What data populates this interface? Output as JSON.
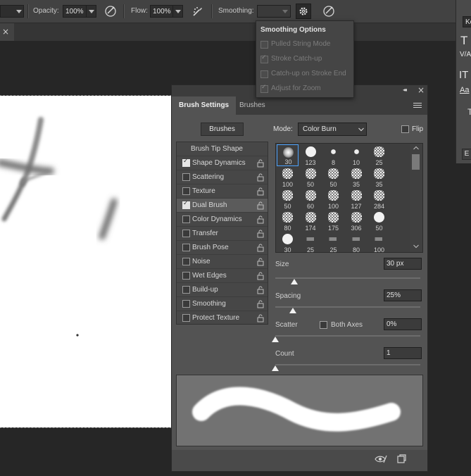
{
  "options_bar": {
    "opacity_label": "Opacity:",
    "opacity_value": "100%",
    "flow_label": "Flow:",
    "flow_value": "100%",
    "smoothing_label": "Smoothing:",
    "smoothing_value": ""
  },
  "tab_strip": {
    "close_glyph": "×"
  },
  "smoothing_popup": {
    "title": "Smoothing Options",
    "items": [
      {
        "label": "Pulled String Mode",
        "checked": false
      },
      {
        "label": "Stroke Catch-up",
        "checked": true
      },
      {
        "label": "Catch-up on Stroke End",
        "checked": false
      },
      {
        "label": "Adjust for Zoom",
        "checked": true
      }
    ]
  },
  "char_panel": {
    "font_field": "Ko",
    "glyphs": [
      "T",
      "V/A",
      "IT",
      "Aa",
      "T",
      "E"
    ]
  },
  "panel": {
    "collapse_glyph": "◂◂",
    "close_glyph": "×",
    "tabs": [
      {
        "label": "Brush Settings",
        "active": true
      },
      {
        "label": "Brushes",
        "active": false
      }
    ],
    "brushes_button": "Brushes",
    "mode_label": "Mode:",
    "mode_value": "Color Burn",
    "flip_label": "Flip",
    "options": [
      {
        "label": "Brush Tip Shape",
        "checked": null,
        "lock": false
      },
      {
        "label": "Shape Dynamics",
        "checked": true,
        "lock": true
      },
      {
        "label": "Scattering",
        "checked": false,
        "lock": true
      },
      {
        "label": "Texture",
        "checked": false,
        "lock": true
      },
      {
        "label": "Dual Brush",
        "checked": true,
        "lock": true,
        "selected": true
      },
      {
        "label": "Color Dynamics",
        "checked": false,
        "lock": true
      },
      {
        "label": "Transfer",
        "checked": false,
        "lock": true
      },
      {
        "label": "Brush Pose",
        "checked": false,
        "lock": true
      },
      {
        "label": "Noise",
        "checked": false,
        "lock": true
      },
      {
        "label": "Wet Edges",
        "checked": false,
        "lock": true
      },
      {
        "label": "Build-up",
        "checked": false,
        "lock": true
      },
      {
        "label": "Smoothing",
        "checked": false,
        "lock": true
      },
      {
        "label": "Protect Texture",
        "checked": false,
        "lock": true
      }
    ],
    "brush_sizes": [
      "30",
      "123",
      "8",
      "10",
      "25",
      "100",
      "50",
      "50",
      "35",
      "35",
      "50",
      "60",
      "100",
      "127",
      "284",
      "80",
      "174",
      "175",
      "306",
      "50",
      "30",
      "25",
      "25",
      "80",
      "100"
    ],
    "size_label": "Size",
    "size_value": "30 px",
    "spacing_label": "Spacing",
    "spacing_value": "25%",
    "scatter_label": "Scatter",
    "both_axes_label": "Both Axes",
    "scatter_value": "0%",
    "count_label": "Count",
    "count_value": "1",
    "size_fraction": 0.13,
    "spacing_fraction": 0.12,
    "scatter_fraction": 0.0,
    "count_fraction": 0.0
  }
}
